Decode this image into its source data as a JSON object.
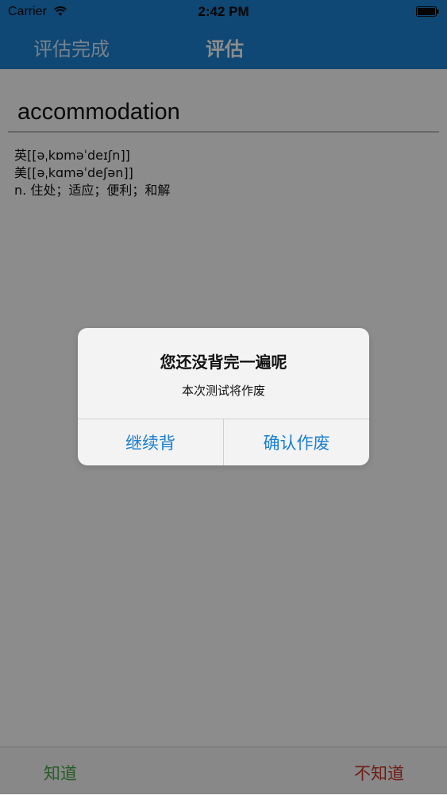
{
  "status_bar": {
    "carrier": "Carrier",
    "time": "2:42 PM"
  },
  "nav": {
    "left_button": "评估完成",
    "title": "评估"
  },
  "word": {
    "text": "accommodation",
    "uk_pron": "英[[əˌkɒməˈdeɪʃn]]",
    "us_pron": "美[[əˌkɑməˈdeʃən]]",
    "definition": "n. 住处；适应；便利；和解"
  },
  "toolbar": {
    "know": "知道",
    "dont_know": "不知道"
  },
  "alert": {
    "title": "您还没背完一遍呢",
    "message": "本次测试将作废",
    "continue_label": "继续背",
    "confirm_label": "确认作废"
  },
  "colors": {
    "accent": "#1c83d3",
    "know": "#4aa84a",
    "dont_know": "#c8372b",
    "alert_button": "#1a7fd2"
  }
}
